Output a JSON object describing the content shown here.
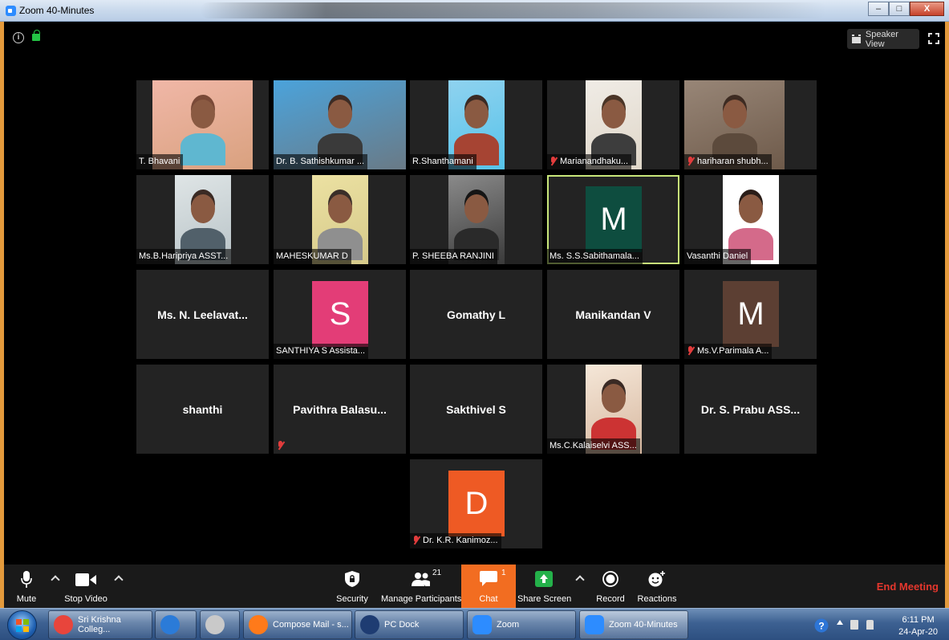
{
  "window": {
    "title": "Zoom 40-Minutes",
    "minimize": "–",
    "maximize": "□",
    "close": "X"
  },
  "top": {
    "speaker_view": "Speaker View"
  },
  "participants": [
    {
      "name": "T. Bhavani",
      "type": "video"
    },
    {
      "name": "Dr. B. Sathishkumar ...",
      "type": "video"
    },
    {
      "name": "R.Shanthamani",
      "type": "video"
    },
    {
      "name": "Marianandhaku...",
      "type": "video",
      "muted": true
    },
    {
      "name": "hariharan shubh...",
      "type": "video",
      "muted": true
    },
    {
      "name": "Ms.B.Haripriya ASST...",
      "type": "video"
    },
    {
      "name": "MAHESKUMAR D",
      "type": "video"
    },
    {
      "name": "P. SHEEBA RANJINI",
      "type": "video"
    },
    {
      "name": "Ms. S.S.Sabithamala...",
      "type": "avatar",
      "initial": "M",
      "color": "#0e4d3f",
      "active": true
    },
    {
      "name": "Vasanthi Daniel",
      "type": "video"
    },
    {
      "name": "Ms. N. Leelavat...",
      "type": "name"
    },
    {
      "name": "SANTHIYA S Assista...",
      "type": "avatar",
      "initial": "S",
      "color": "#e33d77"
    },
    {
      "name": "Gomathy L",
      "type": "name"
    },
    {
      "name": "Manikandan V",
      "type": "name"
    },
    {
      "name": "Ms.V.Parimala A...",
      "type": "avatar",
      "initial": "M",
      "color": "#5c3f33",
      "muted": true
    },
    {
      "name": "shanthi",
      "type": "name"
    },
    {
      "name": "Pavithra  Balasu...",
      "type": "name",
      "muted": true
    },
    {
      "name": "Sakthivel S",
      "type": "name"
    },
    {
      "name": "Ms.C.Kalaiselvi ASS...",
      "type": "video"
    },
    {
      "name": "Dr. S. Prabu ASS...",
      "type": "name"
    },
    {
      "name": "Dr. K.R. Kanimoz...",
      "type": "avatar",
      "initial": "D",
      "color": "#ee5a24",
      "muted": true
    }
  ],
  "toolbar": {
    "mute": "Mute",
    "stop_video": "Stop Video",
    "security": "Security",
    "manage_participants": "Manage Participants",
    "participant_count": "21",
    "chat": "Chat",
    "chat_count": "1",
    "share_screen": "Share Screen",
    "record": "Record",
    "reactions": "Reactions",
    "end_meeting": "End Meeting"
  },
  "taskbar": {
    "tasks": [
      {
        "label": "Sri Krishna Colleg...",
        "icon": "chrome-icon",
        "color": "#e8453c"
      },
      {
        "label": "",
        "icon": "ie-icon",
        "color": "#2b7bd8"
      },
      {
        "label": "",
        "icon": "files-icon",
        "color": "#c9c9c9"
      },
      {
        "label": "Compose Mail - s...",
        "icon": "firefox-icon",
        "color": "#ff7a1a"
      },
      {
        "label": "PC Dock",
        "icon": "hp-icon",
        "color": "#1e3c72"
      },
      {
        "label": "Zoom",
        "icon": "zoom-icon",
        "color": "#2d8cff"
      },
      {
        "label": "Zoom 40-Minutes",
        "icon": "zoom-icon",
        "color": "#2d8cff"
      }
    ],
    "time": "6:11 PM",
    "date": "24-Apr-20"
  }
}
